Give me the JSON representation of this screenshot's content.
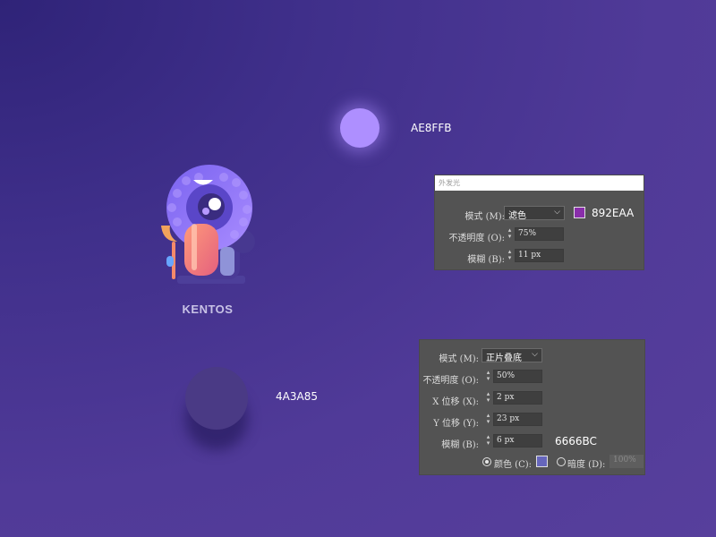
{
  "glow_example": {
    "color": "#AE8FFF",
    "label": "AE8FFB"
  },
  "shadow_example": {
    "color": "#4A3A85",
    "label": "4A3A85"
  },
  "brand": {
    "name": "KENTOS"
  },
  "outer_glow_panel": {
    "title": "外发光",
    "mode_label": "模式 (M):",
    "mode_value": "滤色",
    "color_hex_label": "892EAA",
    "color": "#892EAA",
    "opacity_label": "不透明度 (O):",
    "opacity_value": "75%",
    "blur_label": "模糊 (B):",
    "blur_value": "11 px"
  },
  "drop_shadow_panel": {
    "mode_label": "模式 (M):",
    "mode_value": "正片叠底",
    "opacity_label": "不透明度 (O):",
    "opacity_value": "50%",
    "x_offset_label": "X 位移 (X):",
    "x_offset_value": "2 px",
    "y_offset_label": "Y 位移 (Y):",
    "y_offset_value": "23 px",
    "blur_label": "模糊 (B):",
    "blur_value": "6 px",
    "color_hex_label": "6666BC",
    "color": "#6666BC",
    "color_option_label": "颜色 (C):",
    "darkness_option_label": "暗度 (D):",
    "darkness_value": "100%"
  }
}
